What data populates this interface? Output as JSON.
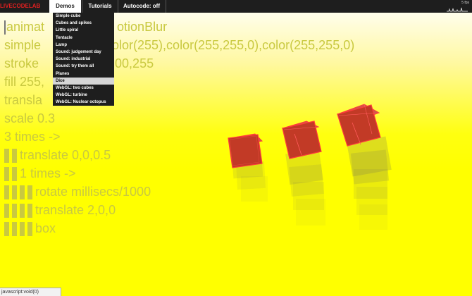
{
  "topbar": {
    "logo": "LIVECODELAB",
    "demos": "Demos",
    "tutorials": "Tutorials",
    "autocode": "Autocode: off",
    "fps": "5 fps"
  },
  "demos_menu": [
    "Simple cube",
    "Cubes and spikes",
    "Little spiral",
    "Tentacle",
    "Lamp",
    "Sound: judgement day",
    "Sound: industrial",
    "Sound: try them all",
    "Planes",
    "Dice",
    "WebGL: two cubes",
    "WebGL: turbine",
    "WebGL: Nuclear octopus"
  ],
  "selected_demo": "Dice",
  "code_lines": [
    "animat",
    "otionBlur",
    "simple",
    "olor(255),color(255,255,0),color(255,255,0)",
    "stroke",
    "00,255",
    "fill 255,",
    "transla",
    "scale 0.3",
    "3 times ->",
    "translate 0,0,0.5",
    "1 times ->",
    "rotate millisecs/1000",
    "translate 2,0,0",
    "box"
  ],
  "status_text": "javascript:void(0)",
  "colors": {
    "code_text": "#c9c940",
    "cube_fill": "#c23a26",
    "cube_edge": "#ff3333",
    "menu_bg": "#1e1e1e",
    "logo": "#e02020"
  }
}
